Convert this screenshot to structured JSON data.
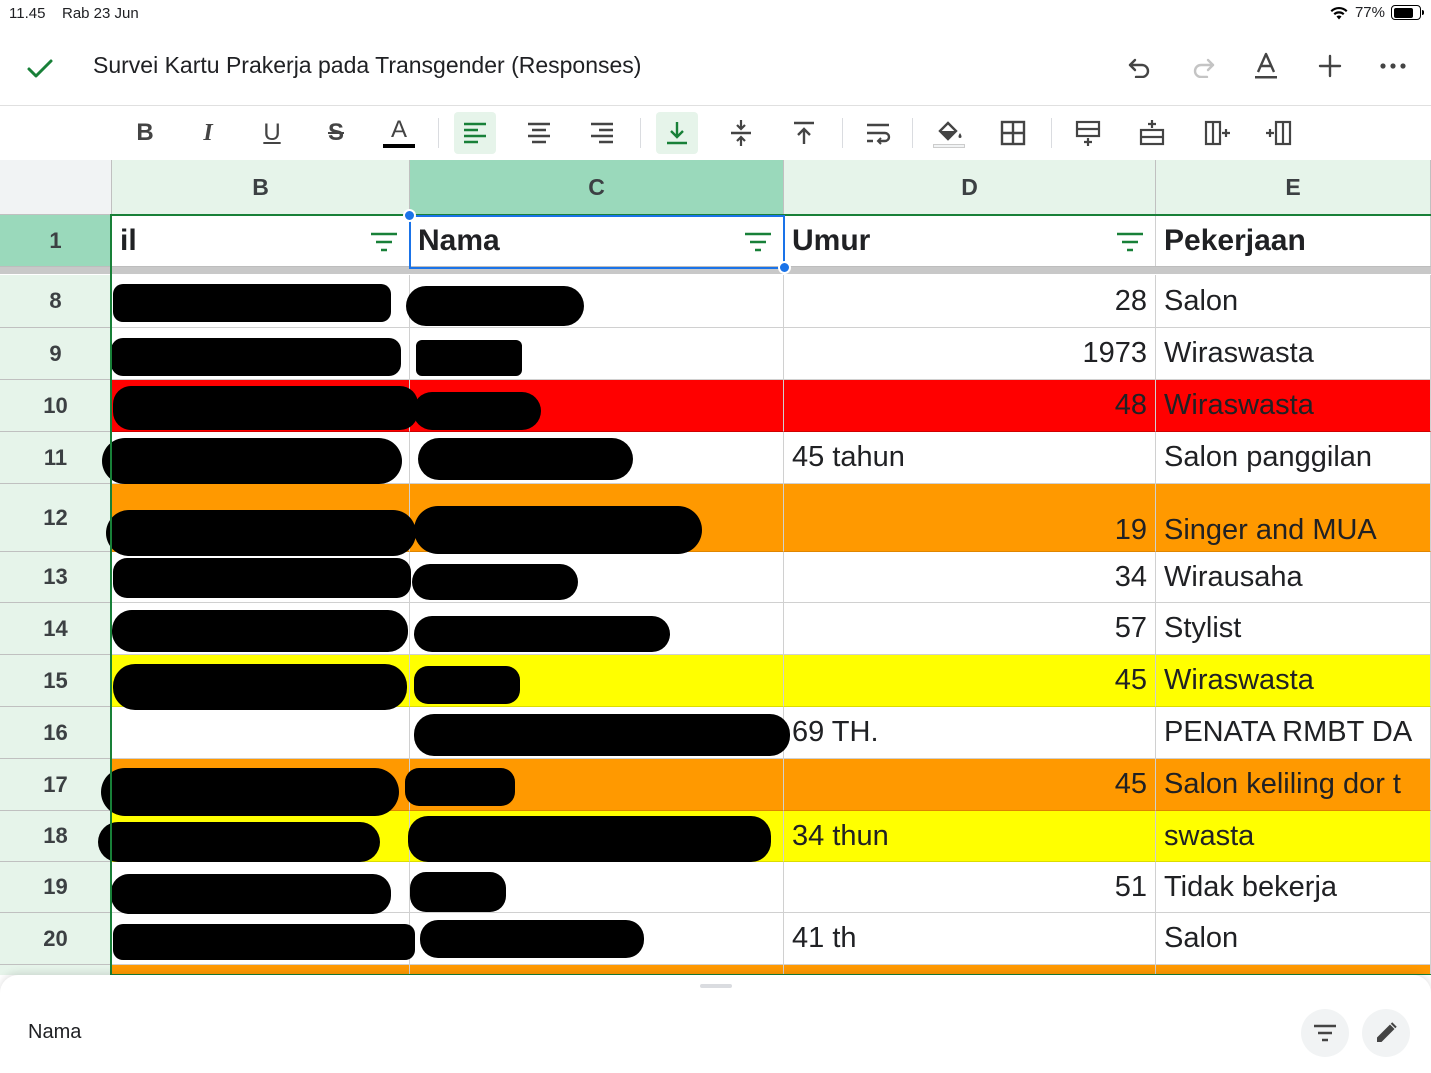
{
  "status_bar": {
    "time": "11.45",
    "date": "Rab 23 Jun",
    "battery": "77%"
  },
  "title_bar": {
    "title": "Survei Kartu Prakerja pada Transgender (Responses)",
    "icons": [
      "check-icon",
      "undo-icon",
      "redo-icon",
      "text-format-icon",
      "add-icon",
      "more-icon"
    ]
  },
  "toolbar": {
    "icons": [
      "bold",
      "italic",
      "underline",
      "strikethrough",
      "text-color",
      "align-left",
      "align-center",
      "align-right",
      "valign-bottom",
      "valign-middle",
      "valign-top",
      "wrap",
      "fill-color",
      "borders",
      "insert-row-above",
      "insert-row-below",
      "insert-col-left",
      "insert-col-right"
    ],
    "labels": {
      "bold": "B",
      "italic": "I",
      "underline": "U",
      "strike": "S",
      "color": "A"
    }
  },
  "columns": [
    "B",
    "C",
    "D",
    "E"
  ],
  "header_row": {
    "row_number": "1",
    "cells": [
      "il",
      "Nama",
      "Umur",
      "Pekerjaan"
    ]
  },
  "rows": [
    {
      "num": "8",
      "umur": "28",
      "pekerjaan": "Salon",
      "fill": "#ffffff"
    },
    {
      "num": "9",
      "umur": "1973",
      "pekerjaan": "Wiraswasta",
      "fill": "#ffffff"
    },
    {
      "num": "10",
      "umur": "48",
      "pekerjaan": "Wiraswasta",
      "fill": "#ff0000"
    },
    {
      "num": "11",
      "umur": "45 tahun",
      "pekerjaan": "Salon panggilan",
      "fill": "#ffffff"
    },
    {
      "num": "12",
      "umur": "19",
      "pekerjaan": "Singer and MUA",
      "fill": "#ff9900"
    },
    {
      "num": "13",
      "umur": "34",
      "pekerjaan": "Wirausaha",
      "fill": "#ffffff"
    },
    {
      "num": "14",
      "umur": "57",
      "pekerjaan": "Stylist",
      "fill": "#ffffff"
    },
    {
      "num": "15",
      "umur": "45",
      "pekerjaan": "Wiraswasta",
      "fill": "#ffff00"
    },
    {
      "num": "16",
      "umur": "69 TH.",
      "pekerjaan": "PENATA RMBT DA",
      "fill": "#ffffff"
    },
    {
      "num": "17",
      "umur": "45",
      "pekerjaan": "Salon keliling dor t",
      "fill": "#ff9900"
    },
    {
      "num": "18",
      "umur": "34 thun",
      "pekerjaan": "swasta",
      "fill": "#ffff00"
    },
    {
      "num": "19",
      "umur": "51",
      "pekerjaan": "Tidak bekerja",
      "fill": "#ffffff"
    },
    {
      "num": "20",
      "umur": "41 th",
      "pekerjaan": "Salon",
      "fill": "#ffffff"
    }
  ],
  "bottom_bar": {
    "cell_content": "Nama",
    "icons": [
      "filter-icon",
      "edit-icon"
    ]
  },
  "colors": {
    "accent": "#188038",
    "selection": "#1a73e8",
    "header_bg": "#e6f4ea",
    "header_selected_bg": "#9ad9bb"
  }
}
